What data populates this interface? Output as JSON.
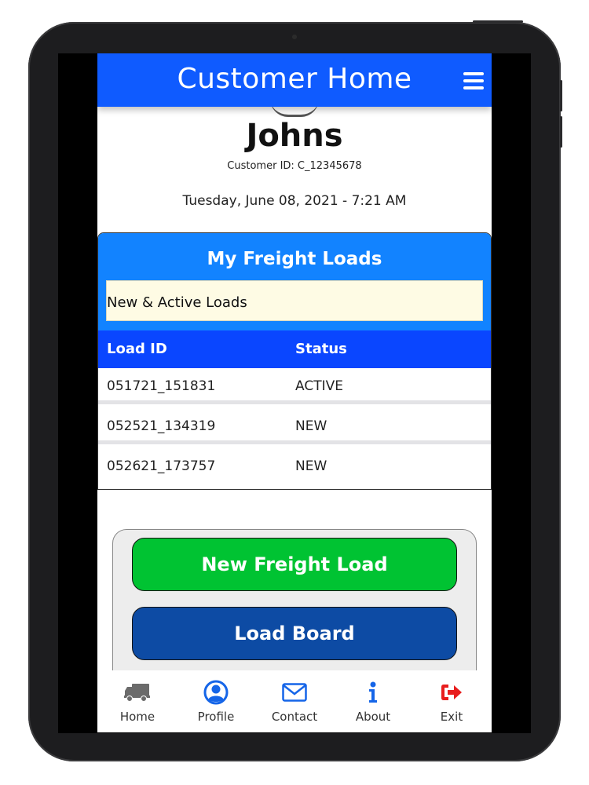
{
  "header": {
    "title": "Customer Home"
  },
  "customer": {
    "name": "Johns",
    "id_text": "Customer ID: C_12345678",
    "datetime": "Tuesday, June 08, 2021 - 7:21 AM"
  },
  "loads": {
    "title": "My Freight Loads",
    "filter_value": "New & Active Loads",
    "columns": [
      "Load ID",
      "Status"
    ],
    "rows": [
      {
        "load_id": "051721_151831",
        "status": "ACTIVE"
      },
      {
        "load_id": "052521_134319",
        "status": "NEW"
      },
      {
        "load_id": "052621_173757",
        "status": "NEW"
      }
    ]
  },
  "actions": {
    "new_freight_load": "New Freight Load",
    "load_board": "Load Board"
  },
  "nav": {
    "items": [
      {
        "label": "Home",
        "icon": "truck-icon"
      },
      {
        "label": "Profile",
        "icon": "user-circle-icon"
      },
      {
        "label": "Contact",
        "icon": "envelope-icon"
      },
      {
        "label": "About",
        "icon": "info-icon"
      },
      {
        "label": "Exit",
        "icon": "sign-out-icon"
      }
    ]
  },
  "colors": {
    "header_blue": "#0f5bff",
    "card_blue": "#1283ff",
    "table_head_blue": "#0a46ff",
    "green": "#00c332",
    "dark_blue": "#0d4ba4",
    "exit_red": "#e81d1d"
  }
}
